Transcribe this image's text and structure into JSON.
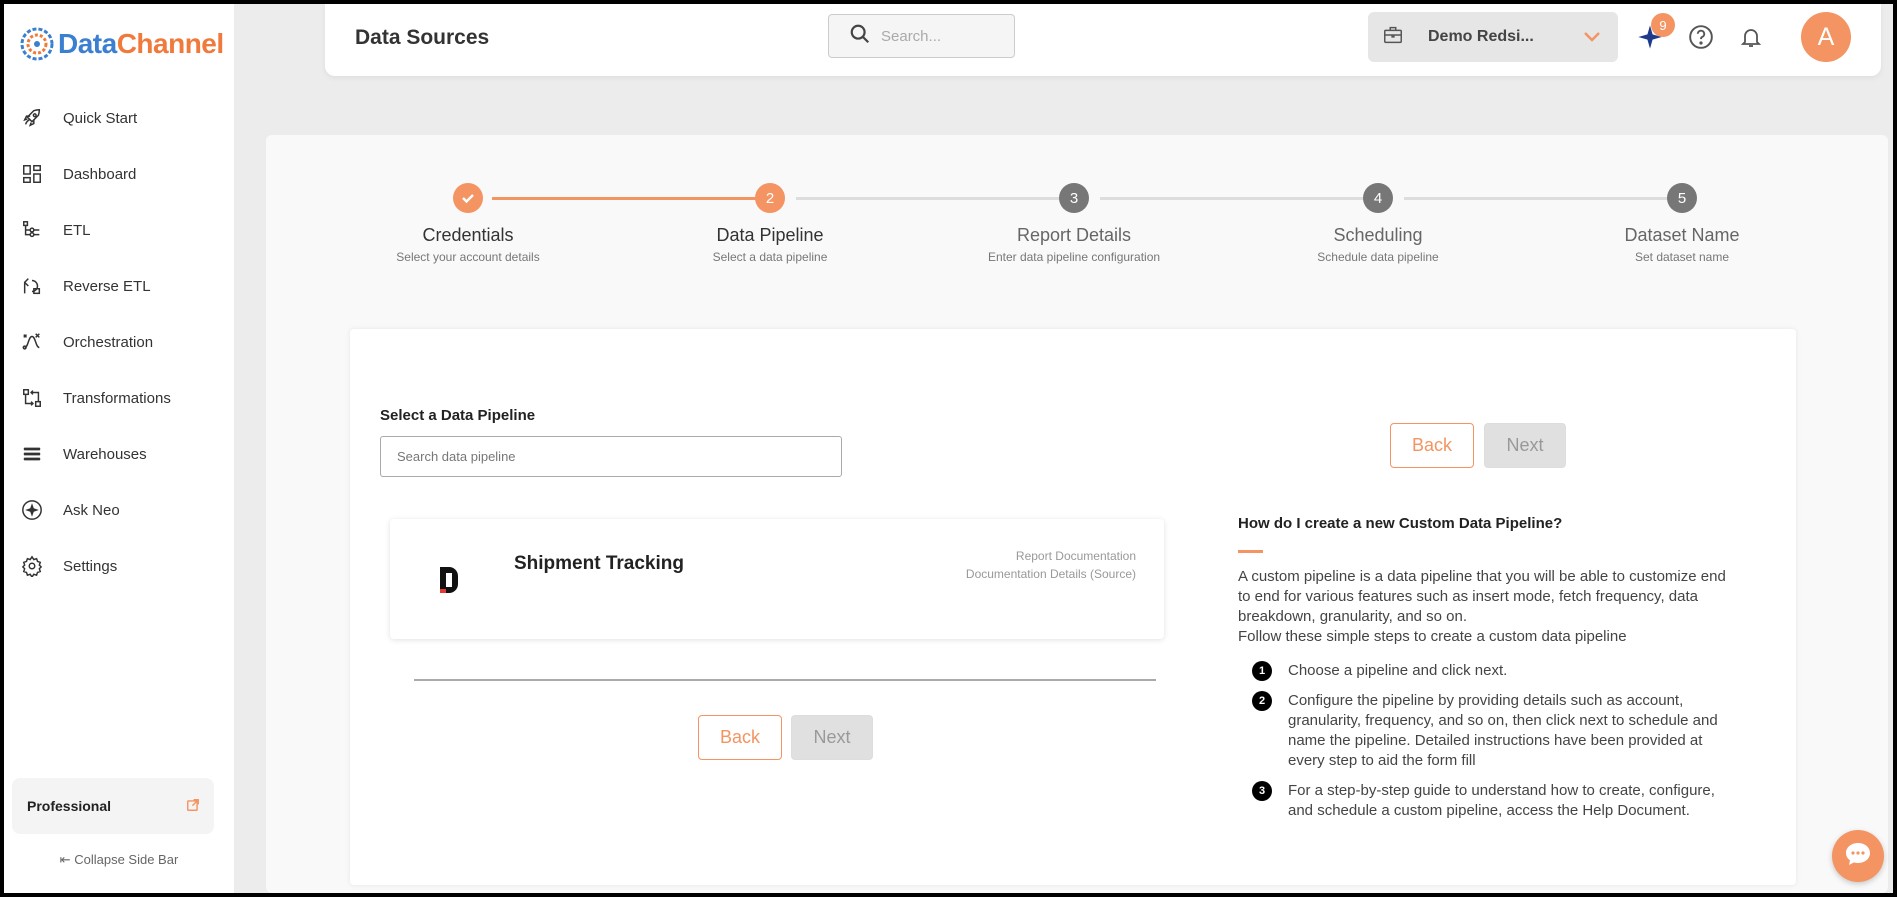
{
  "app": {
    "logo_part1": "Data",
    "logo_part2": "Channel"
  },
  "sidebar": {
    "items": [
      {
        "label": "Quick Start",
        "icon": "rocket-icon"
      },
      {
        "label": "Dashboard",
        "icon": "dashboard-icon"
      },
      {
        "label": "ETL",
        "icon": "etl-icon"
      },
      {
        "label": "Reverse ETL",
        "icon": "reverse-etl-icon"
      },
      {
        "label": "Orchestration",
        "icon": "orchestration-icon"
      },
      {
        "label": "Transformations",
        "icon": "transformations-icon"
      },
      {
        "label": "Warehouses",
        "icon": "warehouses-icon"
      },
      {
        "label": "Ask Neo",
        "icon": "sparkle-icon"
      },
      {
        "label": "Settings",
        "icon": "gear-icon"
      }
    ],
    "plan_label": "Professional",
    "collapse_label": "Collapse Side Bar"
  },
  "header": {
    "title": "Data Sources",
    "search_placeholder": "Search...",
    "workspace_name": "Demo Redsi...",
    "notification_badge": "9",
    "avatar_letter": "A"
  },
  "stepper": {
    "steps": [
      {
        "title": "Credentials",
        "subtitle": "Select your account details",
        "number": "1",
        "state": "done"
      },
      {
        "title": "Data Pipeline",
        "subtitle": "Select a data pipeline",
        "number": "2",
        "state": "active"
      },
      {
        "title": "Report Details",
        "subtitle": "Enter data pipeline configuration",
        "number": "3",
        "state": "pending"
      },
      {
        "title": "Scheduling",
        "subtitle": "Schedule data pipeline",
        "number": "4",
        "state": "pending"
      },
      {
        "title": "Dataset Name",
        "subtitle": "Set dataset name",
        "number": "5",
        "state": "pending"
      }
    ]
  },
  "content": {
    "select_label": "Select a Data Pipeline",
    "search_placeholder": "Search data pipeline",
    "back_label": "Back",
    "next_label": "Next",
    "pipeline": {
      "name": "Shipment Tracking",
      "doc_link_1": "Report Documentation",
      "doc_link_2": "Documentation Details (Source)"
    },
    "help": {
      "title": "How do I create a new Custom Data Pipeline?",
      "text": "A custom pipeline is a data pipeline that you will be able to customize end to end for various features such as insert mode, fetch frequency, data breakdown, granularity, and so on.",
      "text2": "Follow these simple steps to create a custom data pipeline",
      "steps": [
        {
          "num": "1",
          "text": "Choose a pipeline and click next."
        },
        {
          "num": "2",
          "text": "Configure the pipeline by providing details such as account, granularity, frequency, and so on, then click next to schedule and name the pipeline. Detailed instructions have been provided at every step to aid the form fill"
        },
        {
          "num": "3",
          "text": "For a step-by-step guide to understand how to create, configure, and schedule a custom pipeline, access the Help Document."
        }
      ]
    }
  },
  "colors": {
    "accent": "#f39462",
    "logo_blue": "#3b7fd0",
    "logo_orange": "#f07a3c"
  }
}
